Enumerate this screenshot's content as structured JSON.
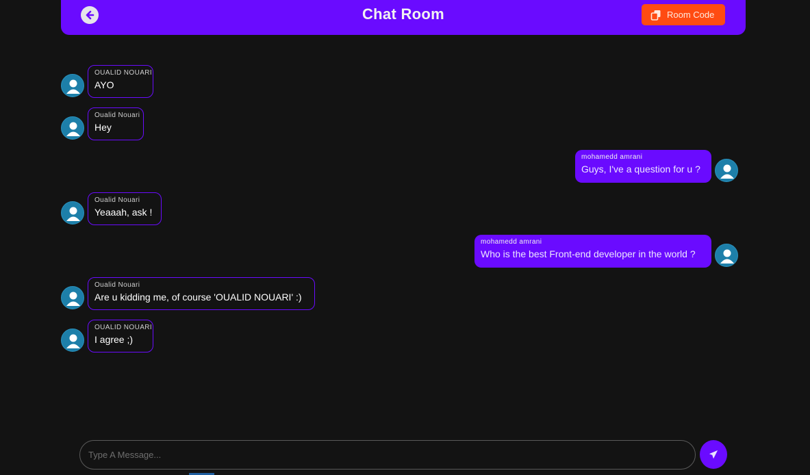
{
  "header": {
    "title": "Chat Room",
    "back_icon": "arrow-left-circle-icon",
    "room_code_label": "Room Code",
    "room_code_icon": "copy-icon",
    "color": "#6a0bff",
    "room_code_color": "#ff4b12"
  },
  "messages": [
    {
      "sender": "OUALID NOUARI",
      "text": "AYO",
      "direction": "in"
    },
    {
      "sender": "Oualid Nouari",
      "text": "Hey",
      "direction": "in"
    },
    {
      "sender": "mohamedd amrani",
      "text": "Guys, I've a question for u ?",
      "direction": "out"
    },
    {
      "sender": "Oualid Nouari",
      "text": "Yeaaah, ask !",
      "direction": "in"
    },
    {
      "sender": "mohamedd amrani",
      "text": "Who is the best Front-end developer in the world ?",
      "direction": "out"
    },
    {
      "sender": "Oualid Nouari",
      "text": "Are u kidding me, of course 'OUALID NOUARI' :)",
      "direction": "in"
    },
    {
      "sender": "OUALID NOUARI",
      "text": "I agree ;)",
      "direction": "in"
    }
  ],
  "composer": {
    "placeholder": "Type A Message...",
    "value": "",
    "send_icon": "paper-plane-icon"
  }
}
